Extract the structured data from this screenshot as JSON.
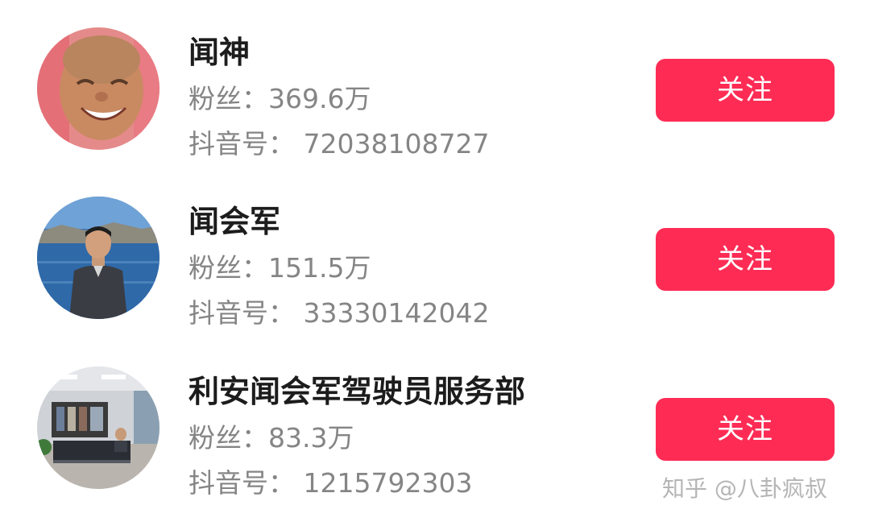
{
  "colors": {
    "follow_button_bg": "#fe2c55",
    "follow_button_text": "#ffffff",
    "name_text": "#1c1c1c",
    "meta_text": "#858585"
  },
  "accounts": [
    {
      "name": "闻神",
      "fans": "粉丝：369.6万",
      "douyin_id": "抖音号： 72038108727",
      "follow_label": "关注",
      "avatar_icon": "smiling-man-photo"
    },
    {
      "name": "闻会军",
      "fans": "粉丝：151.5万",
      "douyin_id": "抖音号： 33330142042",
      "follow_label": "关注",
      "avatar_icon": "man-by-lake-photo"
    },
    {
      "name": "利安闻会军驾驶员服务部",
      "fans": "粉丝：83.3万",
      "douyin_id": "抖音号： 1215792303",
      "follow_label": "关注",
      "avatar_icon": "office-interior-photo"
    }
  ],
  "watermark": "知乎 @八卦疯叔"
}
